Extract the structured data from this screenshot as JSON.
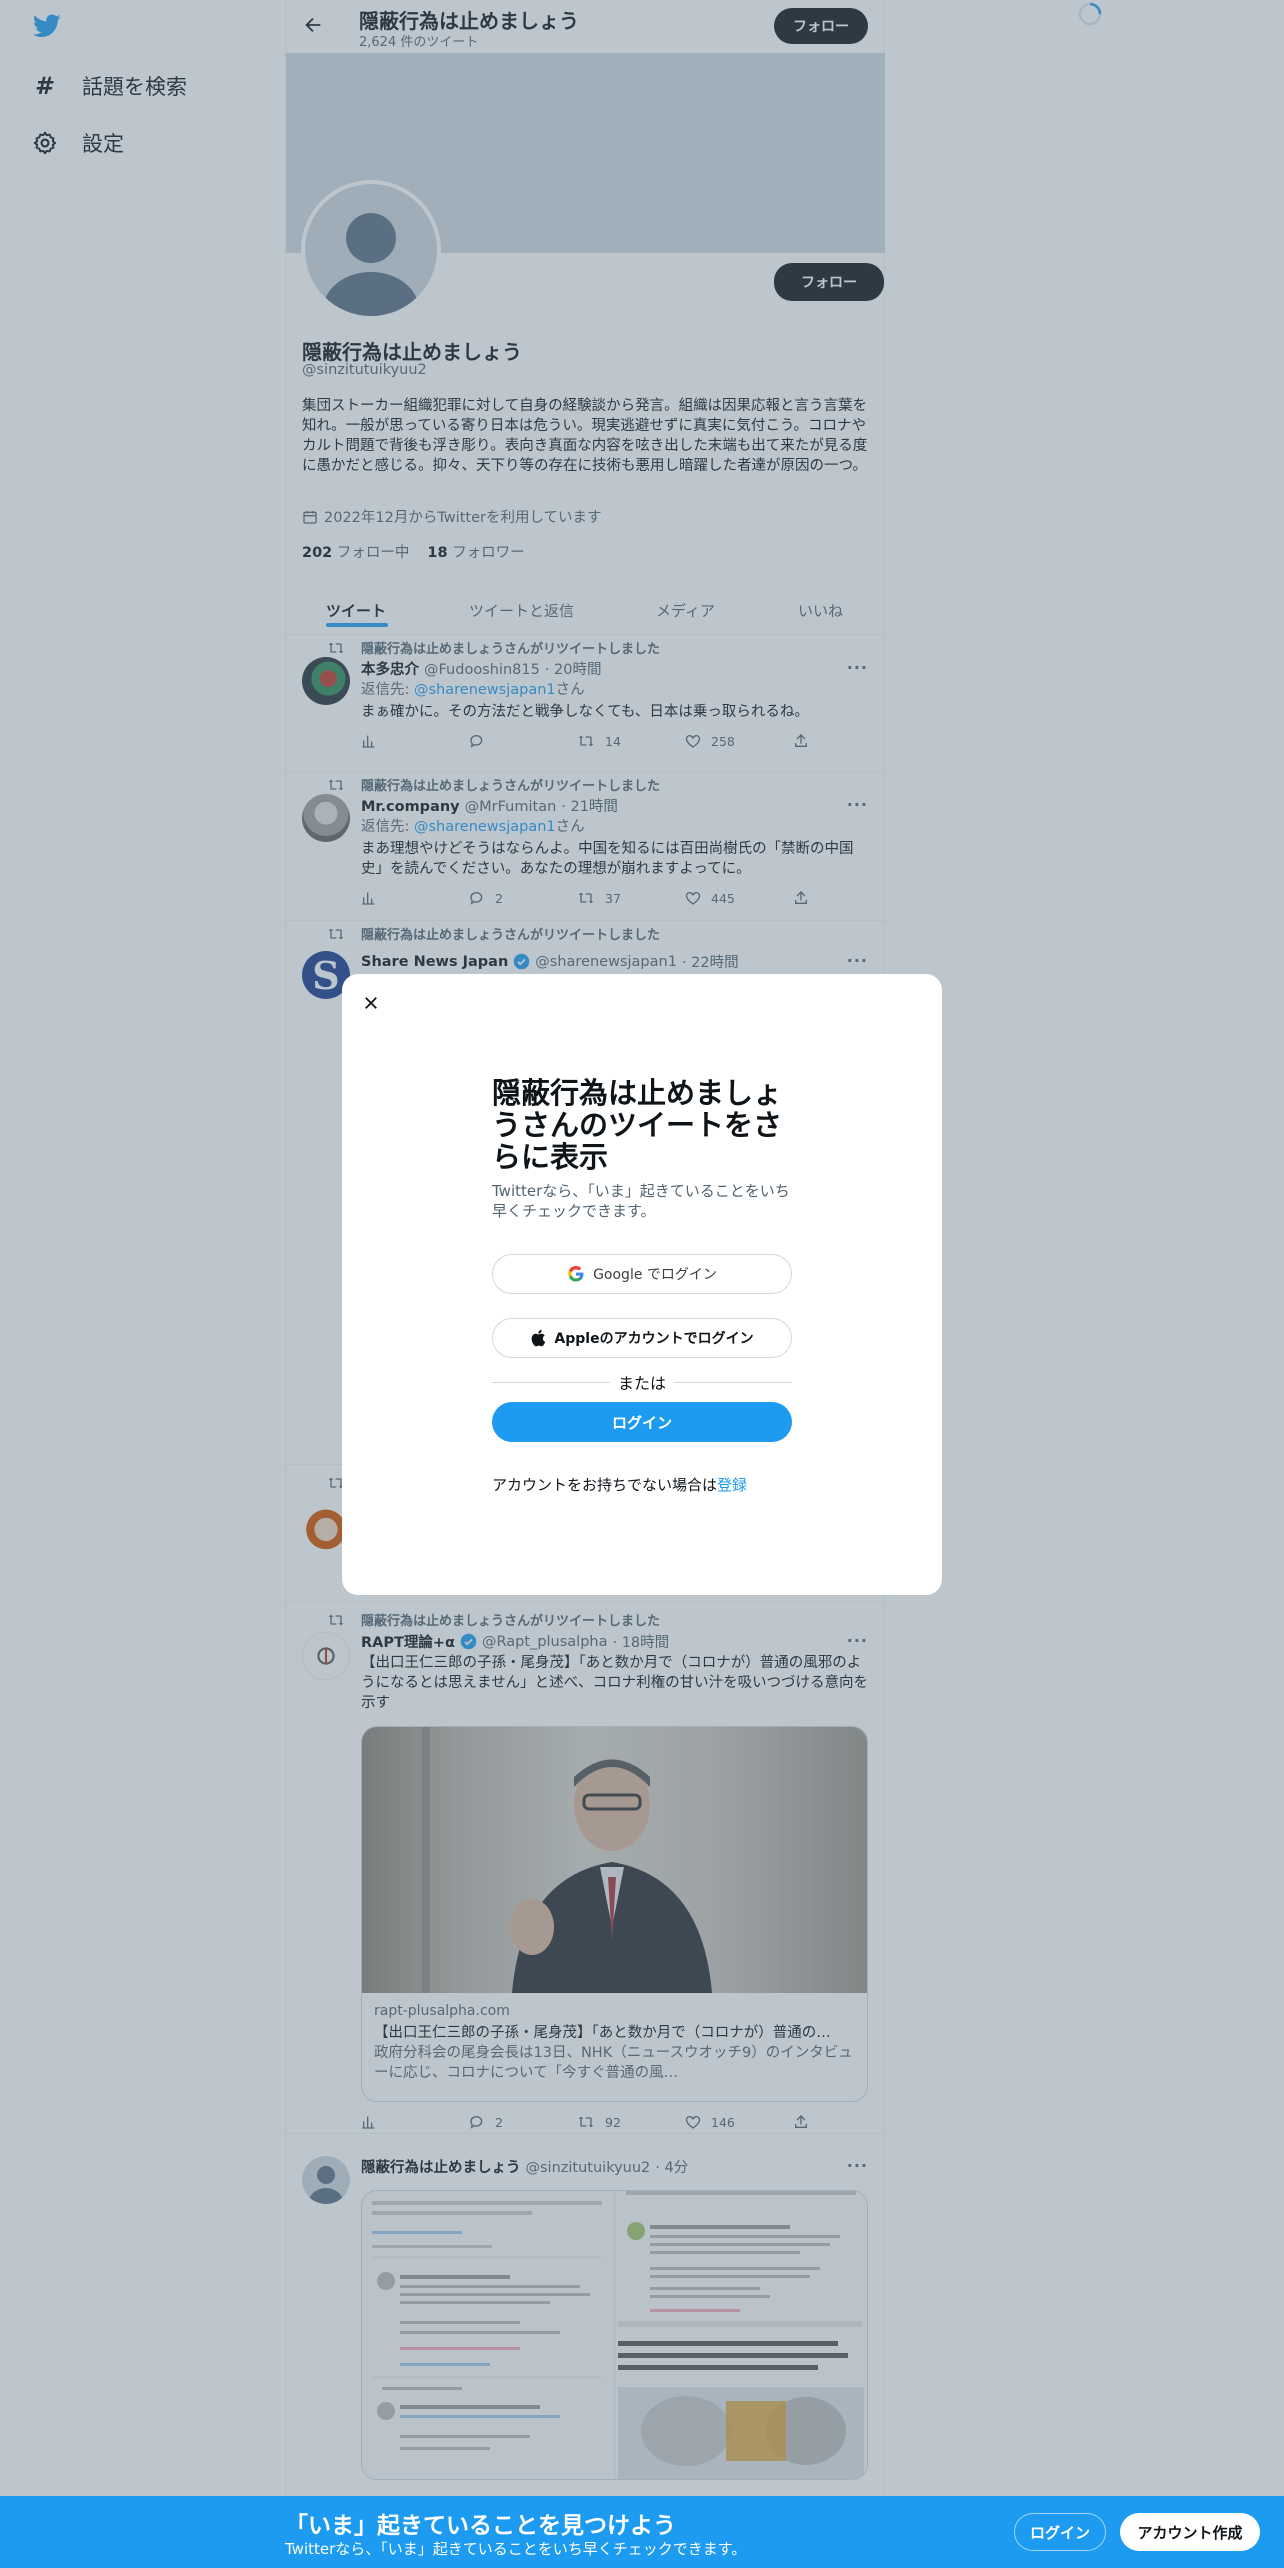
{
  "nav": {
    "explore_label": "話題を検索",
    "settings_label": "設定"
  },
  "header": {
    "title": "隠蔽行為は止めましょう",
    "tweet_count": "2,624 件のツイート",
    "follow_label": "フォロー"
  },
  "profile": {
    "name": "隠蔽行為は止めましょう",
    "handle": "@sinzitutuikyuu2",
    "bio": "集団ストーカー組織犯罪に対して自身の経験談から発言。組織は因果応報と言う言葉を知れ。一般が思っている寄り日本は危うい。現実逃避せずに真実に気付こう。コロナやカルト問題で背後も浮き彫り。表向き真面な内容を呟き出した末端も出て来たが見る度に愚かだと感じる。抑々、天下り等の存在に技術も悪用し暗躍した者達が原因の一つ。",
    "joined": "2022年12月からTwitterを利用しています",
    "following_count": "202",
    "following_label": "フォロー中",
    "followers_count": "18",
    "followers_label": "フォロワー",
    "follow_label": "フォロー"
  },
  "tabs": [
    {
      "label": "ツイート",
      "active": true
    },
    {
      "label": "ツイートと返信",
      "active": false
    },
    {
      "label": "メディア",
      "active": false
    },
    {
      "label": "いいね",
      "active": false
    }
  ],
  "tweets": [
    {
      "retweet_note": "隠蔽行為は止めましょうさんがリツイートしました",
      "name": "本多忠介",
      "handle": "@Fudooshin815",
      "time": "· 20時間",
      "reply_prefix": "返信先: ",
      "reply_to": "@sharenewsjapan1",
      "reply_suffix": "さん",
      "text": "まぁ確かに。その方法だと戦争しなくても、日本は乗っ取られるね。",
      "replies": "",
      "retweets": "14",
      "likes": "258"
    },
    {
      "retweet_note": "隠蔽行為は止めましょうさんがリツイートしました",
      "name": "Mr.company",
      "handle": "@MrFumitan",
      "time": "· 21時間",
      "reply_prefix": "返信先: ",
      "reply_to": "@sharenewsjapan1",
      "reply_suffix": "さん",
      "text": "まあ理想やけどそうはならんよ。中国を知るには百田尚樹氏の「禁断の中国史」を読んでください。あなたの理想が崩れますよってに。",
      "replies": "2",
      "retweets": "37",
      "likes": "445"
    },
    {
      "retweet_note": "隠蔽行為は止めましょうさんがリツイートしました",
      "name": "Share News Japan",
      "handle": "@sharenewsjapan1",
      "time": "· 22時間"
    },
    {
      "retweet_note": "隠蔽行為は止めましょうさんがリツイートしました",
      "name": "RAPT理論+α",
      "handle": "@Rapt_plusalpha",
      "time": "· 18時間",
      "text": "【出口王仁三郎の子孫・尾身茂】「あと数か月で（コロナが）普通の風邪のようになるとは思えません」と述べ、コロナ利権の甘い汁を吸いつづける意向を示す",
      "card_domain": "rapt-plusalpha.com",
      "card_title": "【出口王仁三郎の子孫・尾身茂】「あと数か月で（コロナが）普通の…",
      "card_desc": "政府分科会の尾身会長は13日、NHK（ニュースウオッチ9）のインタビューに応じ、コロナについて「今すぐ普通の風…",
      "replies": "2",
      "retweets": "92",
      "likes": "146"
    },
    {
      "name": "隠蔽行為は止めましょう",
      "handle": "@sinzitutuikyuu2",
      "time": "· 4分"
    }
  ],
  "modal": {
    "title": "隠蔽行為は止めましょうさんのツイートをさらに表示",
    "description": "Twitterなら、「いま」起きていることをいち早くチェックできます。",
    "google_label": "Google でログイン",
    "apple_label": "Appleのアカウントでログイン",
    "or_label": "または",
    "login_label": "ログイン",
    "signup_prompt": "アカウントをお持ちでない場合は",
    "signup_link": "登録"
  },
  "bottom_bar": {
    "headline": "「いま」起きていることを見つけよう",
    "subline": "Twitterなら、「いま」起きていることをいち早くチェックできます。",
    "login_label": "ログイン",
    "signup_label": "アカウント作成"
  },
  "colors": {
    "accent": "#1d9bf0",
    "text": "#0f1419",
    "secondary": "#536471",
    "overlay": "rgba(91,112,131,0.4)"
  }
}
